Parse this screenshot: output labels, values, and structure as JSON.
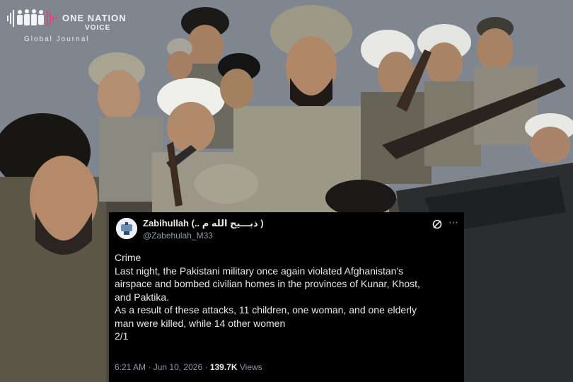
{
  "watermark": {
    "brand": "ONE NATION",
    "brand_line2": "VOICE",
    "tagline": "Global Journal"
  },
  "tweet": {
    "author_name": "Zabihullah (.. ذبـــیح الله م )",
    "author_handle": "@Zabehulah_M33",
    "lines": [
      "Crime",
      "Last night, the Pakistani military once again violated Afghanistan's",
      "airspace and bombed civilian homes in the provinces of Kunar, Khost,",
      "and Paktika.",
      "As a result of these attacks, 11 children, one woman, and one elderly",
      "man were killed, while 14 other women",
      "2/1"
    ],
    "time": "6:21 AM",
    "separator": "·",
    "date": "Jun 10, 2026",
    "views_count": "139.7K",
    "views_label": "Views",
    "more_icon": "⋯"
  },
  "colors": {
    "card_bg": "#000000",
    "text_primary": "#e7e9ea",
    "text_secondary": "#8b98a5"
  }
}
